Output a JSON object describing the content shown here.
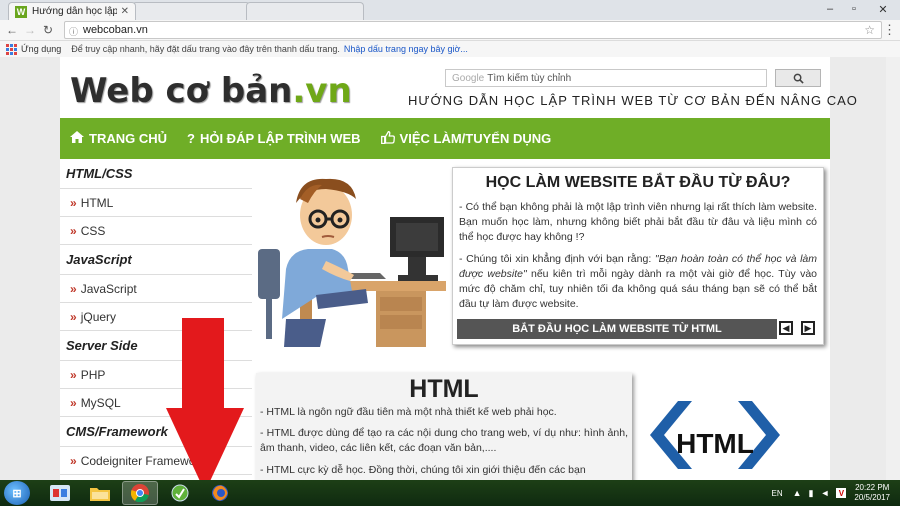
{
  "browser": {
    "active_tab_title": "Hướng dẫn học lập trình",
    "active_tab_favicon": "W",
    "address": "webcoban.vn",
    "bookmarks_apps": "Ứng dụng",
    "bookmarks_hint": "Để truy cập nhanh, hãy đặt dấu trang vào đây trên thanh dấu trang.",
    "bookmarks_link": "Nhập dấu trang ngay bây giờ..."
  },
  "site": {
    "logo_main": "Web cơ bản",
    "logo_tld": ".vn",
    "search_placeholder": "Tìm kiếm tùy chỉnh",
    "search_brand": "Google",
    "tagline": "HƯỚNG DẪN HỌC LẬP TRÌNH WEB TỪ CƠ BẢN ĐẾN NÂNG CAO",
    "nav": [
      {
        "label": "TRANG CHỦ",
        "icon": "home-icon"
      },
      {
        "label": "HỎI ĐÁP LẬP TRÌNH WEB",
        "icon": "question-icon"
      },
      {
        "label": "VIỆC LÀM/TUYỂN DỤNG",
        "icon": "thumbs-up-icon"
      }
    ]
  },
  "sidebar": {
    "sections": [
      {
        "heading": "HTML/CSS",
        "items": [
          "HTML",
          "CSS"
        ]
      },
      {
        "heading": "JavaScript",
        "items": [
          "JavaScript",
          "jQuery"
        ]
      },
      {
        "heading": "Server Side",
        "items": [
          "PHP",
          "MySQL"
        ]
      },
      {
        "heading": "CMS/Framework",
        "items": [
          "Codeigniter Framework"
        ]
      }
    ]
  },
  "hero": {
    "title": "HỌC LÀM WEBSITE BẮT ĐẦU TỪ ĐÂU?",
    "p1": "- Có thể bạn không phải là một lập trình viên nhưng lại rất thích làm website. Bạn muốn học làm, nhưng không biết phải bắt đầu từ đâu và liệu mình có thể học được hay không !?",
    "p2_pre": "- Chúng tôi xin khẳng định với bạn rằng: ",
    "p2_quote": "\"Bạn hoàn toàn có thể học và làm được website\"",
    "p2_post": " nếu kiên trì mỗi ngày dành ra một vài giờ để học. Tùy vào mức độ chăm chỉ, tuy nhiên tối đa không quá sáu tháng bạn sẽ có thể bắt đầu tự làm được website.",
    "cta": "BẮT ĐẦU HỌC LÀM WEBSITE TỪ HTML"
  },
  "html_section": {
    "title": "HTML",
    "p1": "- HTML là ngôn ngữ đầu tiên mà một nhà thiết kế web phải học.",
    "p2": "- HTML được dùng để tạo ra các nội dung cho trang web, ví dụ như: hình ảnh, âm thanh, video, các liên kết, các đoạn văn bản,....",
    "p3": "- HTML cực kỳ dễ học. Đồng thời, chúng tôi xin giới thiệu đến các bạn",
    "badge": "HTML"
  },
  "taskbar": {
    "lang": "EN",
    "time": "20:22 PM",
    "date": "20/5/2017"
  },
  "colors": {
    "brand_green": "#6fae27",
    "arrow_red": "#e3191c"
  }
}
